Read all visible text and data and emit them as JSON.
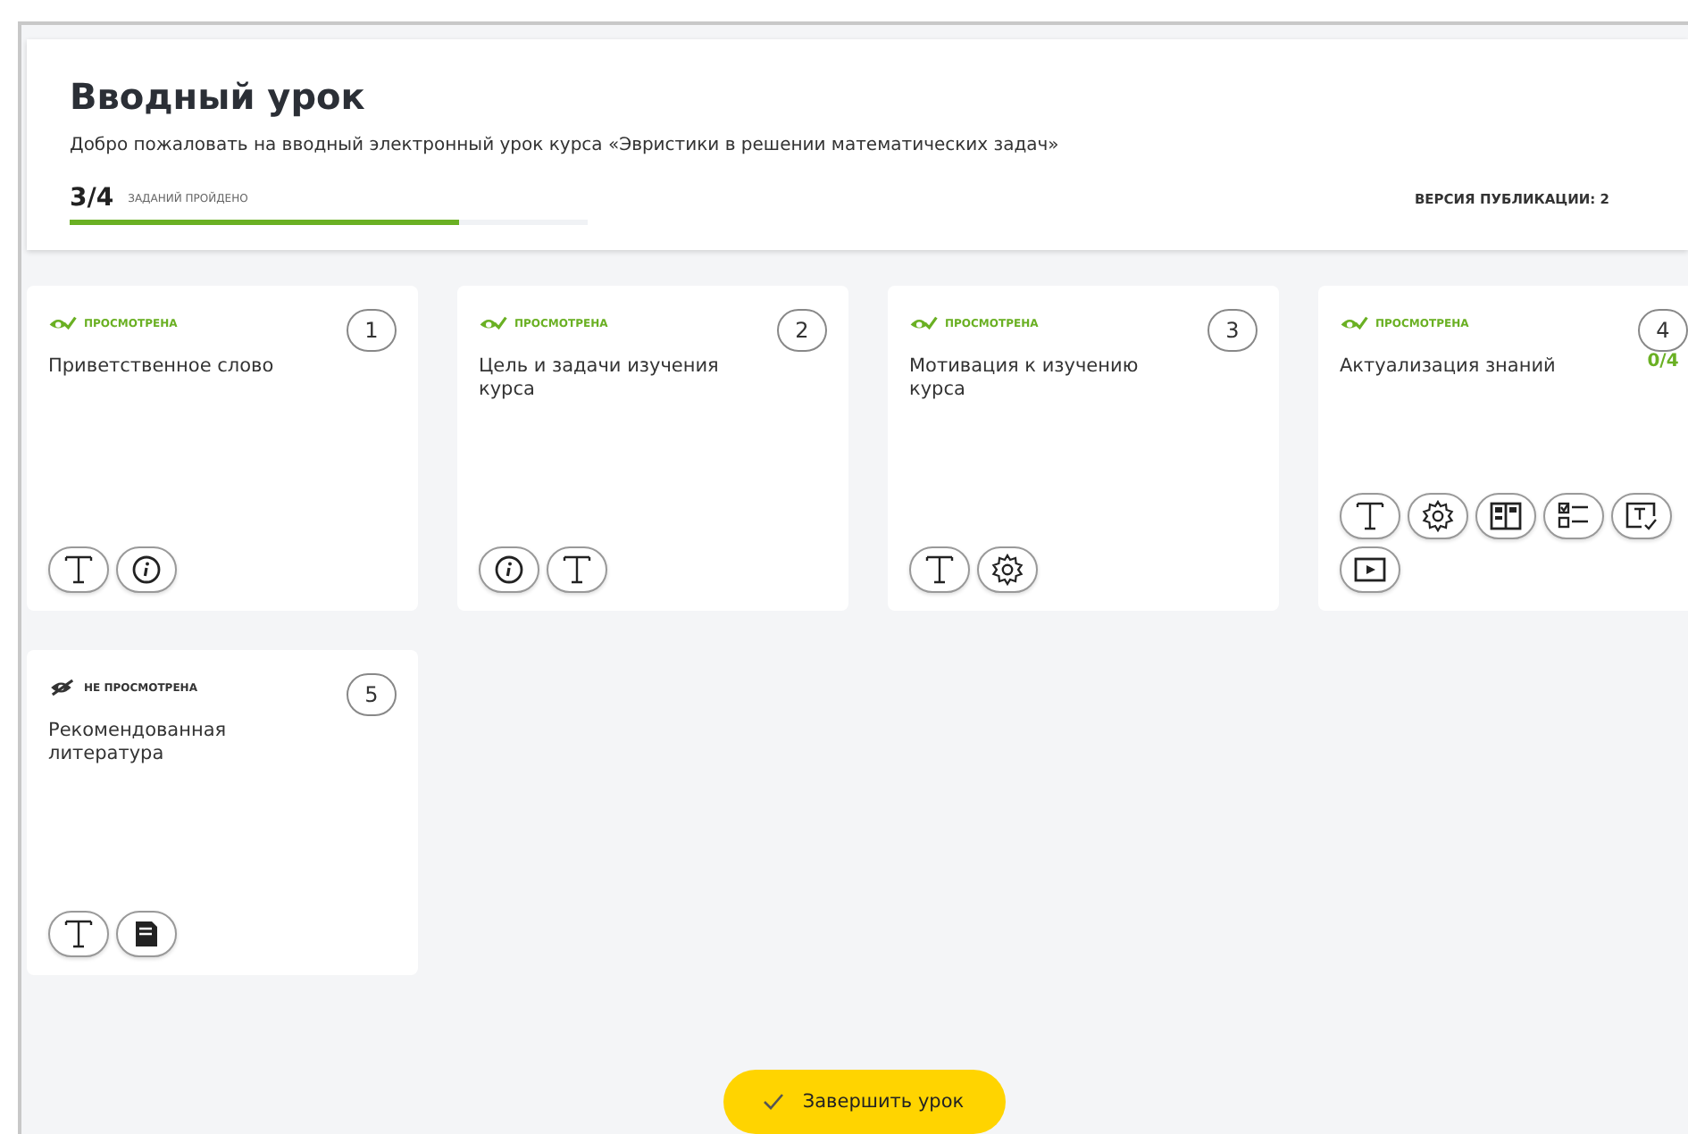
{
  "header": {
    "title": "Вводный урок",
    "description": "Добро пожаловать на вводный электронный урок курса «Эвристики в решении математических задач»",
    "progress_count": "3/4",
    "progress_label": "ЗАДАНИЙ ПРОЙДЕНО",
    "level": 0.75,
    "version": "ВЕРСИЯ ПУБЛИКАЦИИ: 2"
  },
  "cards": [
    {
      "status": "ПРОСМОТРЕНА",
      "viewed": true,
      "number": "1",
      "title": "Приветственное слово",
      "tools": [
        {
          "kind": "text"
        },
        {
          "kind": "info"
        }
      ]
    },
    {
      "status": "ПРОСМОТРЕНА",
      "viewed": true,
      "number": "2",
      "title": "Цель и задачи изучения курса",
      "tools": [
        {
          "kind": "info"
        },
        {
          "kind": "text"
        }
      ]
    },
    {
      "status": "ПРОСМОТРЕНА",
      "viewed": true,
      "number": "3",
      "title": "Мотивация к изучению курса",
      "tools": [
        {
          "kind": "text"
        },
        {
          "kind": "gear"
        }
      ]
    },
    {
      "status": "ПРОСМОТРЕНА",
      "viewed": true,
      "number": "4",
      "score": "0/4",
      "title": "Актуализация знаний",
      "tools": [
        {
          "kind": "text"
        },
        {
          "kind": "gear"
        },
        {
          "kind": "columns"
        },
        {
          "kind": "checklist"
        },
        {
          "kind": "textcheck"
        },
        {
          "kind": "video"
        }
      ]
    },
    {
      "status": "НЕ ПРОСМОТРЕНА",
      "viewed": false,
      "number": "5",
      "title": "Рекомендованная литература",
      "tools": [
        {
          "kind": "text"
        },
        {
          "kind": "document"
        }
      ]
    }
  ],
  "finish_button": "Завершить урок"
}
